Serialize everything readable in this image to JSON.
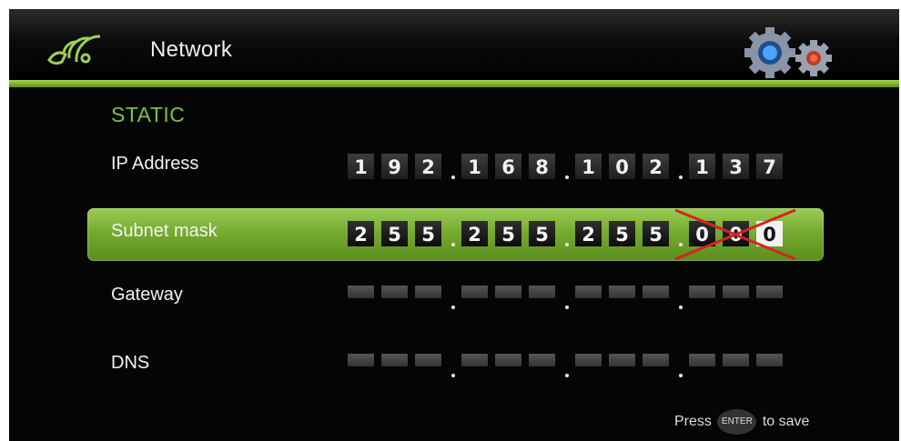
{
  "header": {
    "title": "Network",
    "icon": "wireless-signal-icon",
    "settings_icon": "gears-icon"
  },
  "colors": {
    "accent": "#7dc242",
    "highlight": "#7fb536",
    "background": "#050505"
  },
  "network": {
    "mode": "STATIC",
    "ip_address": {
      "label": "IP Address",
      "digits": [
        "1",
        "9",
        "2",
        "1",
        "6",
        "8",
        "1",
        "0",
        "2",
        "1",
        "3",
        "7"
      ]
    },
    "subnet_mask": {
      "label": "Subnet mask",
      "digits": [
        "2",
        "5",
        "5",
        "2",
        "5",
        "5",
        "2",
        "5",
        "5",
        "0",
        "0",
        "0"
      ],
      "cursor_digit": "0"
    },
    "gateway": {
      "label": "Gateway"
    },
    "dns": {
      "label": "DNS"
    }
  },
  "footer": {
    "press": "Press",
    "key": "ENTER",
    "action": "to save"
  }
}
